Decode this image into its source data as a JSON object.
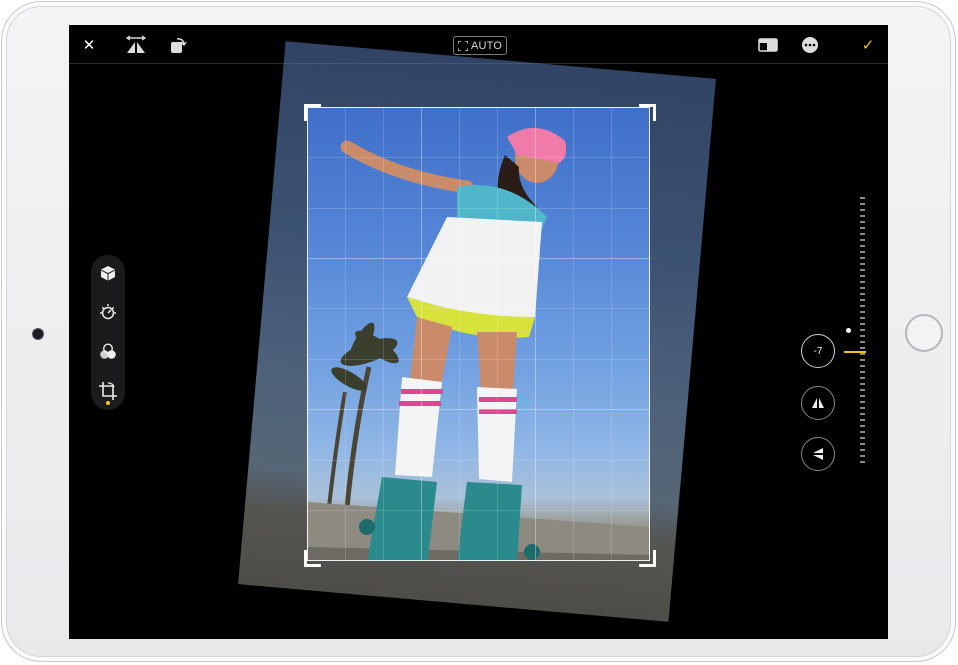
{
  "toolbar": {
    "close_icon": "close-icon",
    "auto_label": "AUTO",
    "done_icon": "checkmark-icon",
    "accent_color": "#f5c518"
  },
  "tools": [
    "adjust-icon",
    "filters-icon",
    "crop-icon"
  ],
  "straighten": {
    "value_label": "-7"
  },
  "icons": {
    "flip": "flip-horizontal-icon",
    "rotate": "rotate-icon",
    "aspect": "aspect-ratio-icon",
    "more": "more-icon",
    "vertical": "vertical-perspective-icon",
    "horizontal": "horizontal-perspective-icon"
  }
}
